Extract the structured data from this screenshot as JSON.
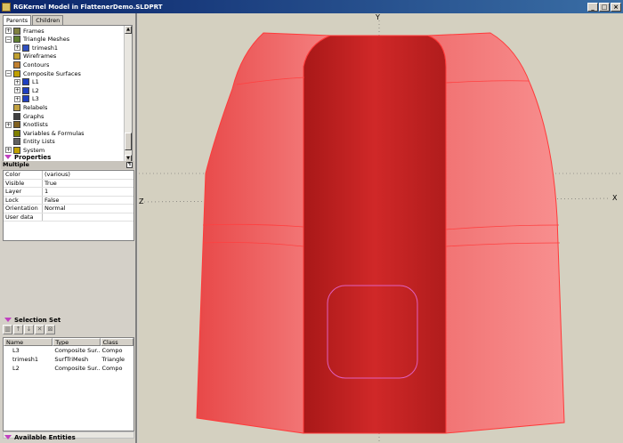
{
  "window": {
    "title": "RGKernel Model in FlattenerDemo.SLDPRT",
    "minimize_glyph": "_",
    "maximize_glyph": "□",
    "close_glyph": "×"
  },
  "tabs": [
    {
      "label": "Parents"
    },
    {
      "label": "Children"
    }
  ],
  "tree": {
    "items": [
      {
        "label": "Frames",
        "expander": "+",
        "icon": "frames-icon"
      },
      {
        "label": "Triangle Meshes",
        "expander": "−",
        "icon": "mesh-icon"
      },
      {
        "label": "trimesh1",
        "expander": "+",
        "icon": "trimesh-icon"
      },
      {
        "label": "Wireframes",
        "expander": "",
        "icon": "wireframe-icon"
      },
      {
        "label": "Contours",
        "expander": "",
        "icon": "contour-icon"
      },
      {
        "label": "Composite Surfaces",
        "expander": "−",
        "icon": "surface-icon"
      },
      {
        "label": "L1",
        "expander": "+",
        "icon": "surface-l-icon"
      },
      {
        "label": "L2",
        "expander": "+",
        "icon": "surface-l-icon"
      },
      {
        "label": "L3",
        "expander": "+",
        "icon": "surface-l-icon"
      },
      {
        "label": "Relabels",
        "expander": "",
        "icon": "relabel-icon"
      },
      {
        "label": "Graphs",
        "expander": "",
        "icon": "graph-icon"
      },
      {
        "label": "Knotlists",
        "expander": "+",
        "icon": "knot-icon"
      },
      {
        "label": "Variables & Formulas",
        "expander": "",
        "icon": "variable-icon"
      },
      {
        "label": "Entity Lists",
        "expander": "",
        "icon": "list-icon"
      },
      {
        "label": "System",
        "expander": "+",
        "icon": "system-icon"
      }
    ]
  },
  "properties": {
    "header": "Properties",
    "subheader": "Multiple",
    "pin_glyph": "¶",
    "rows": [
      {
        "key": "Color",
        "value": "(various)"
      },
      {
        "key": "Visible",
        "value": "True"
      },
      {
        "key": "Layer",
        "value": "1"
      },
      {
        "key": "Lock",
        "value": "False"
      },
      {
        "key": "Orientation",
        "value": "Normal"
      },
      {
        "key": "User data",
        "value": ""
      }
    ]
  },
  "selection_set": {
    "header": "Selection Set",
    "toolbar": [
      {
        "name": "columns-icon",
        "glyph": "▥"
      },
      {
        "name": "arrow-up-icon",
        "glyph": "↑"
      },
      {
        "name": "arrow-down-icon",
        "glyph": "↓"
      },
      {
        "name": "remove-icon",
        "glyph": "✕"
      },
      {
        "name": "clear-icon",
        "glyph": "⊠"
      }
    ],
    "columns": [
      "Name",
      "Type",
      "Class"
    ],
    "rows": [
      {
        "name": "L3",
        "type": "Composite Sur...",
        "class": "Compo"
      },
      {
        "name": "trimesh1",
        "type": "SurfTriMesh",
        "class": "Triangle"
      },
      {
        "name": "L2",
        "type": "Composite Sur...",
        "class": "Compo"
      }
    ]
  },
  "available_entities": {
    "header": "Available Entities"
  },
  "viewport": {
    "axes": {
      "y": "Y",
      "x": "X",
      "z": "Z"
    },
    "colors": {
      "background": "#d4d0c0",
      "surface_light": "#f06a6a",
      "surface_mid": "#e04848",
      "surface_dark": "#c02828",
      "edge": "#ff3030",
      "selection_outline": "#e060c0"
    }
  }
}
